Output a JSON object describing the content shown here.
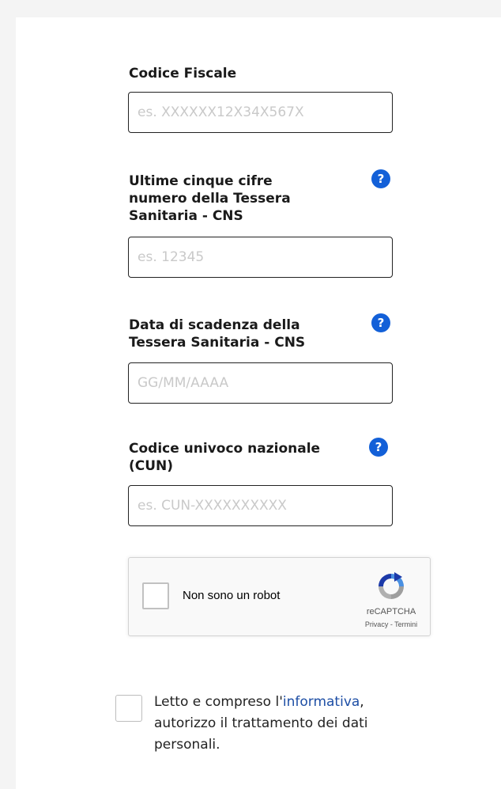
{
  "form": {
    "fiscal_code": {
      "label": "Codice Fiscale",
      "placeholder": "es. XXXXXX12X34X567X",
      "value": ""
    },
    "card_digits": {
      "label": "Ultime cinque cifre numero della Tessera Sanitaria - CNS",
      "placeholder": "es. 12345",
      "value": "",
      "help_icon": "?"
    },
    "expiry_date": {
      "label": "Data di scadenza della Tessera Sanitaria - CNS",
      "placeholder": "GG/MM/AAAA",
      "value": "",
      "help_icon": "?"
    },
    "cun": {
      "label": "Codice univoco nazionale (CUN)",
      "placeholder": "es. CUN-XXXXXXXXXX",
      "value": "",
      "help_icon": "?"
    }
  },
  "recaptcha": {
    "label": "Non sono un robot",
    "brand": "reCAPTCHA",
    "privacy_link": "Privacy",
    "separator": " - ",
    "terms_link": "Termini",
    "checked": false
  },
  "consent": {
    "text_before": "Letto e compreso l'",
    "link_text": "informativa",
    "text_after": ", autorizzo il trattamento dei dati personali.",
    "checked": false
  },
  "colors": {
    "help_icon": "#1360d8",
    "link": "#1d4ea5",
    "input_border": "#222222",
    "placeholder": "#c9c9c9"
  }
}
